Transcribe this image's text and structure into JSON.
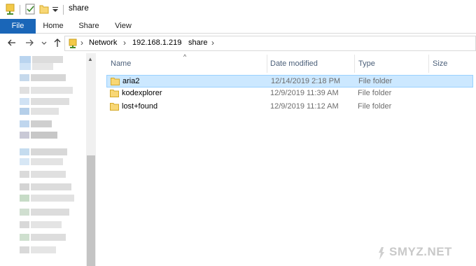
{
  "window": {
    "title": "share"
  },
  "ribbon": {
    "tabs": [
      {
        "label": "File"
      },
      {
        "label": "Home"
      },
      {
        "label": "Share"
      },
      {
        "label": "View"
      }
    ]
  },
  "address": {
    "crumbs": [
      "Network",
      "192.168.1.219",
      "share"
    ]
  },
  "columns": {
    "name": "Name",
    "date": "Date modified",
    "type": "Type",
    "size": "Size"
  },
  "files": [
    {
      "name": "aria2",
      "date": "12/14/2019 2:18 PM",
      "type": "File folder",
      "selected": true
    },
    {
      "name": "kodexplorer",
      "date": "12/9/2019 11:39 AM",
      "type": "File folder",
      "selected": false
    },
    {
      "name": "lost+found",
      "date": "12/9/2019 11:12 AM",
      "type": "File folder",
      "selected": false
    }
  ],
  "colors": {
    "accent": "#1a66b8",
    "selection": "#cce8ff",
    "selection_border": "#99d1ff",
    "folder": "#f8d775"
  },
  "icons": {
    "back": "arrow-left-icon",
    "forward": "arrow-right-icon",
    "recent": "chevron-down-icon",
    "up": "arrow-up-icon",
    "folder": "folder-icon"
  },
  "watermark": "SMYZ.NET"
}
